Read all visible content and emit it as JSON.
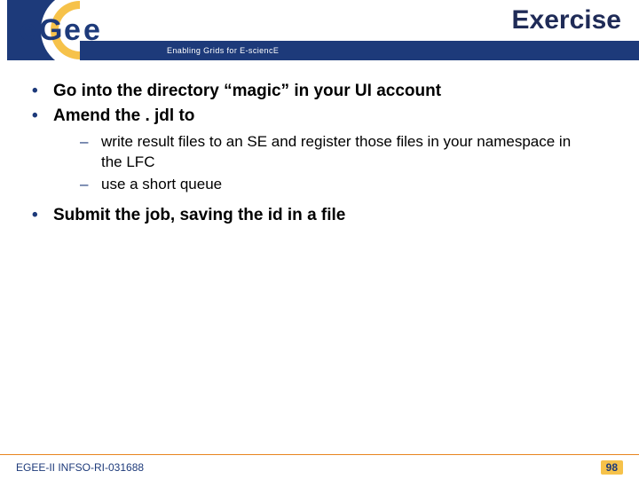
{
  "header": {
    "title": "Exercise",
    "tagline": "Enabling Grids for E-sciencE",
    "logo_text": "eGee"
  },
  "content": {
    "bullets": [
      {
        "text": "Go into the directory “magic” in your UI account"
      },
      {
        "text": "Amend the . jdl to",
        "sub": [
          "write result files to an SE and register those files in your namespace in the LFC",
          "use a short queue"
        ]
      },
      {
        "text": "Submit the job, saving the id in a file"
      }
    ]
  },
  "footer": {
    "left": "EGEE-II INFSO-RI-031688",
    "right": "98"
  },
  "colors": {
    "brand_blue": "#1d3a7a",
    "brand_orange": "#e8851f",
    "brand_yellow": "#f6c24a"
  }
}
